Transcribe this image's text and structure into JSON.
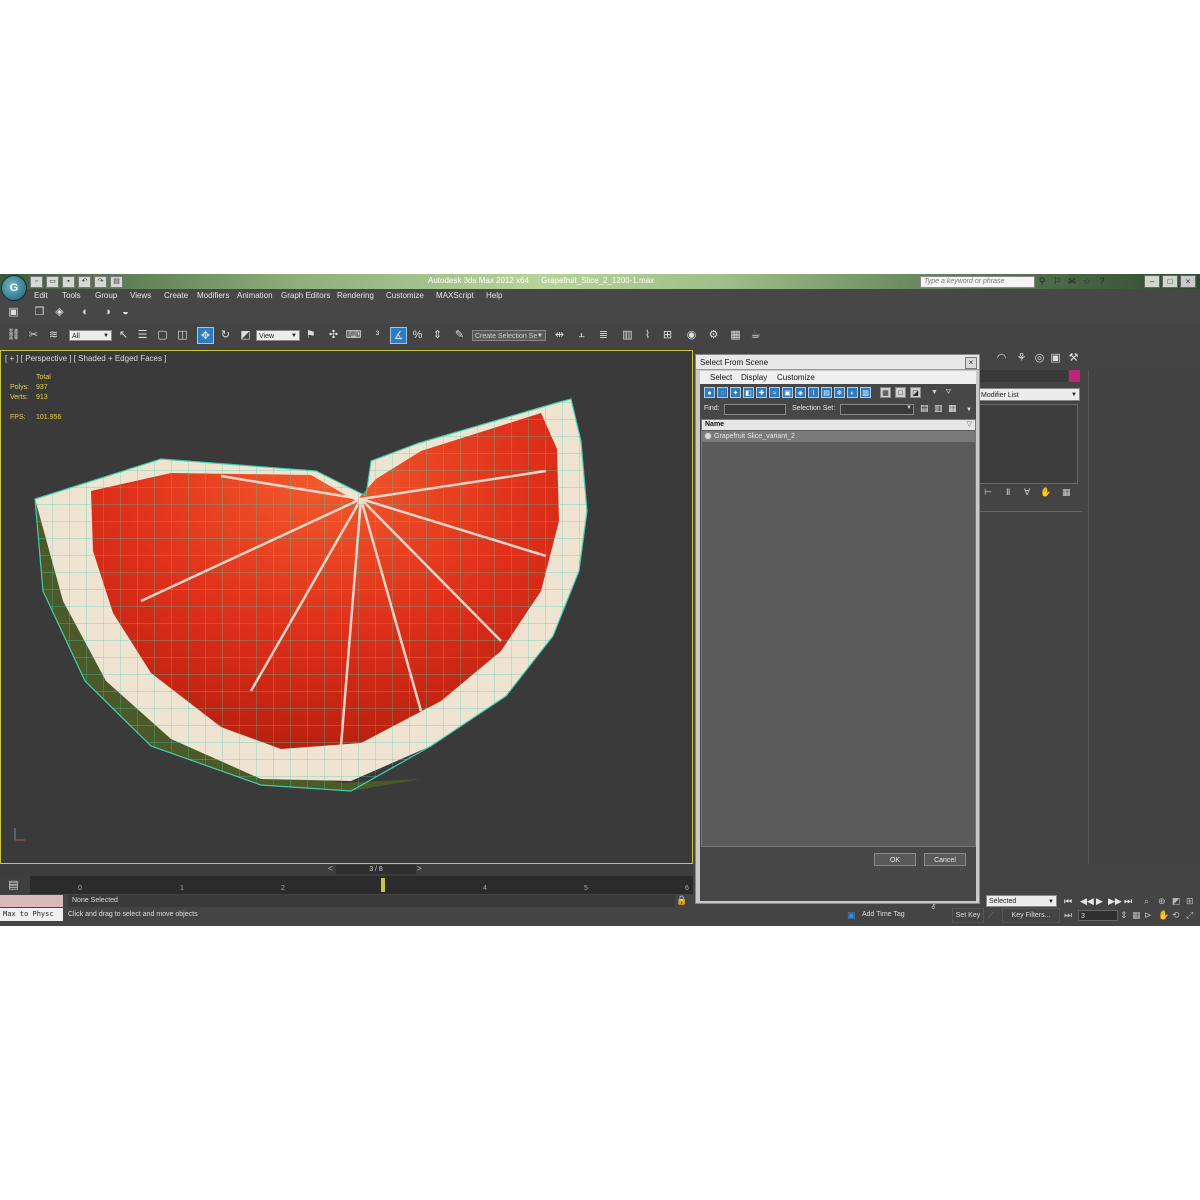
{
  "title_bar": {
    "app_name": "Autodesk 3ds Max  2012 x64",
    "file_name": "Grapefruit_Slice_2_1200-1.max",
    "search_placeholder": "Type a keyword or phrase"
  },
  "menu": [
    "Edit",
    "Tools",
    "Group",
    "Views",
    "Create",
    "Modifiers",
    "Animation",
    "Graph Editors",
    "Rendering",
    "Customize",
    "MAXScript",
    "Help"
  ],
  "toolbar": {
    "filter_value": "All",
    "reference_value": "View",
    "selection_set_placeholder": "Create Selection Se"
  },
  "viewport": {
    "label": "[ + ] [ Perspective ] [ Shaded + Edged Faces ]",
    "stats": {
      "header": "Total",
      "polys_label": "Polys:",
      "polys_value": "937",
      "verts_label": "Verts:",
      "verts_value": "913",
      "fps_label": "FPS:",
      "fps_value": "101.956"
    }
  },
  "timeline": {
    "frame_display": "3 / 8",
    "ticks": [
      "0",
      "1",
      "2",
      "4",
      "5",
      "6"
    ]
  },
  "status": {
    "script_listener": "Max to Physc",
    "selection": "None Selected",
    "prompt": "Click and drag to select and move objects",
    "add_time_tag": "Add Time Tag",
    "set_key": "Set Key",
    "key_filters": "Key Filters...",
    "selected_dropdown": "Selected",
    "current_frame": "3"
  },
  "command_panel": {
    "modifier_list": "Modifier List"
  },
  "dialog": {
    "title": "Select From Scene",
    "menu": [
      "Select",
      "Display",
      "Customize"
    ],
    "find_label": "Find:",
    "selection_set_label": "Selection Set:",
    "column_header": "Name",
    "items": [
      "Grapefruit Slice_variant_2"
    ],
    "ok_label": "OK",
    "cancel_label": "Cancel"
  },
  "colors": {
    "accent_blue": "#2f7bbf",
    "viewport_border": "#c8c83a",
    "stats_text": "#e5d04a",
    "wireframe": "#3fcfb0",
    "fruit_flesh": "#e0301a",
    "object_color": "#c0247a"
  }
}
